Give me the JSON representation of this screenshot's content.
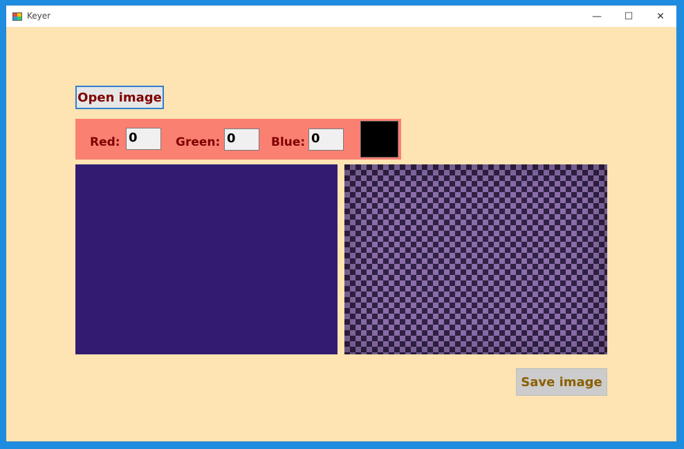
{
  "window": {
    "title": "Keyer",
    "icons": {
      "app": "keyer-app-icon",
      "minimize": "minimize-icon",
      "maximize": "maximize-icon",
      "close": "close-icon"
    },
    "minimize_glyph": "—",
    "maximize_glyph": "☐",
    "close_glyph": "✕"
  },
  "toolbar": {
    "open_label": "Open image"
  },
  "color_key": {
    "red_label": "Red:",
    "red_value": "0",
    "green_label": "Green:",
    "green_value": "0",
    "blue_label": "Blue:",
    "blue_value": "0",
    "swatch_color": "#000000"
  },
  "images": {
    "source_color": "#321c72",
    "result_pattern": "checkerboard"
  },
  "footer": {
    "save_label": "Save image"
  },
  "colors": {
    "background": "#fde4b2",
    "panel": "#fa8072",
    "label_text": "#800000",
    "save_text": "#8a6000",
    "accent_border": "#2f7fd0"
  }
}
